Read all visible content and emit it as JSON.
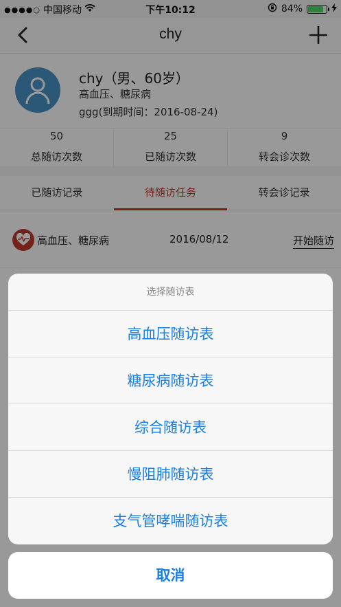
{
  "status_bar": {
    "signal_dots": "●●●●○",
    "carrier": "中国移动",
    "time": "下午10:12",
    "battery_percent": "84%",
    "battery_level": 0.84
  },
  "navbar": {
    "title": "chy"
  },
  "patient": {
    "name": "chy（男、60岁）",
    "diagnosis": "高血压、糖尿病",
    "expire": "ggg(到期时间：2016-08-24)"
  },
  "stats": [
    {
      "value": "50",
      "label": "总随访次数"
    },
    {
      "value": "25",
      "label": "已随访次数"
    },
    {
      "value": "9",
      "label": "转会诊次数"
    }
  ],
  "tabs": [
    {
      "label": "已随访记录",
      "active": false
    },
    {
      "label": "待随访任务",
      "active": true
    },
    {
      "label": "转会诊记录",
      "active": false
    }
  ],
  "tasks": [
    {
      "diagnosis": "高血压、糖尿病",
      "date": "2016/08/12",
      "action": "开始随访"
    }
  ],
  "action_sheet": {
    "title": "选择随访表",
    "options": [
      "高血压随访表",
      "糖尿病随访表",
      "综合随访表",
      "慢阻肺随访表",
      "支气管哮喘随访表"
    ],
    "cancel": "取消"
  },
  "colors": {
    "accent_red": "#c0392b",
    "ios_blue": "#1a7ee0",
    "avatar_blue": "#4a93c9",
    "battery_green": "#4cd964"
  }
}
